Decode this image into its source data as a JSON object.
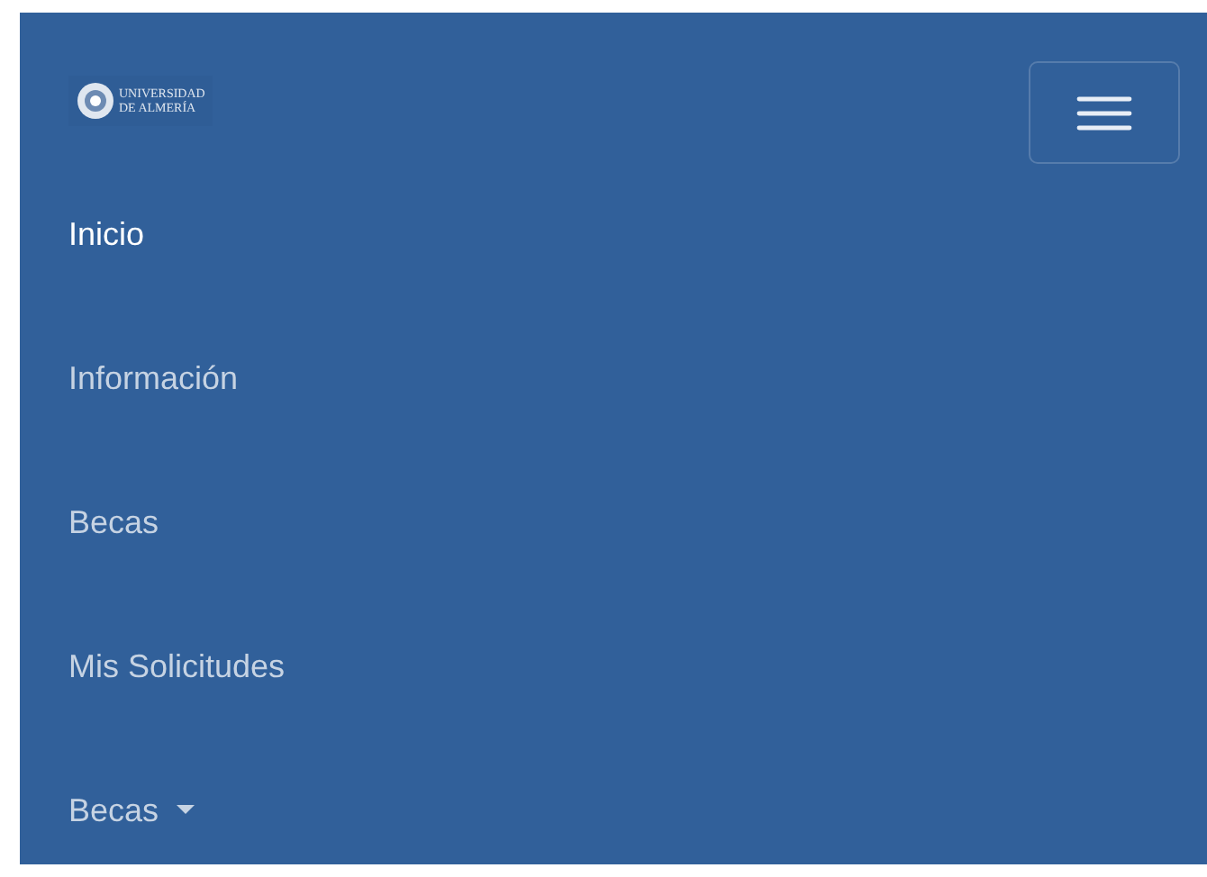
{
  "logo": {
    "lines": [
      "UNIVERSIDAD",
      "DE ALMERÍA"
    ]
  },
  "menu_items": [
    {
      "label": "Inicio",
      "selected": true,
      "kind": "link"
    },
    {
      "label": "Información",
      "selected": false,
      "kind": "link"
    },
    {
      "label": "Becas",
      "selected": false,
      "kind": "link"
    },
    {
      "label": "Mis Solicitudes",
      "selected": false,
      "kind": "link"
    },
    {
      "label": "Becas",
      "selected": false,
      "kind": "dropdown"
    }
  ]
}
